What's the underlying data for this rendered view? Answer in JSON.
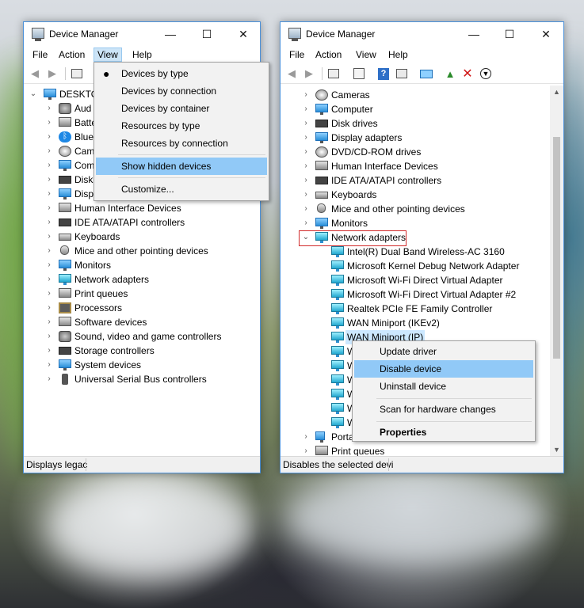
{
  "left_window": {
    "title": "Device Manager",
    "window_controls": {
      "minimize": "—",
      "maximize": "☐",
      "close": "✕"
    },
    "menu": [
      "File",
      "Action",
      "View",
      "Help"
    ],
    "active_menu": "View",
    "tree_root": "DESKTO",
    "tree_items": [
      "Aud",
      "Batte",
      "Blue",
      "Cam",
      "Com",
      "Disk",
      "Disp",
      "Human Interface Devices",
      "IDE ATA/ATAPI controllers",
      "Keyboards",
      "Mice and other pointing devices",
      "Monitors",
      "Network adapters",
      "Print queues",
      "Processors",
      "Software devices",
      "Sound, video and game controllers",
      "Storage controllers",
      "System devices",
      "Universal Serial Bus controllers"
    ],
    "status_text": "Displays legac",
    "view_menu": {
      "items": [
        {
          "label": "Devices by type",
          "checked": true
        },
        {
          "label": "Devices by connection",
          "checked": false
        },
        {
          "label": "Devices by container",
          "checked": false
        },
        {
          "label": "Resources by type",
          "checked": false
        },
        {
          "label": "Resources by connection",
          "checked": false
        }
      ],
      "show_hidden": "Show hidden devices",
      "customize": "Customize..."
    }
  },
  "right_window": {
    "title": "Device Manager",
    "window_controls": {
      "minimize": "—",
      "maximize": "☐",
      "close": "✕"
    },
    "menu": [
      "File",
      "Action",
      "View",
      "Help"
    ],
    "tree_items": [
      "Cameras",
      "Computer",
      "Disk drives",
      "Display adapters",
      "DVD/CD-ROM drives",
      "Human Interface Devices",
      "IDE ATA/ATAPI controllers",
      "Keyboards",
      "Mice and other pointing devices",
      "Monitors"
    ],
    "expanded_category": "Network adapters",
    "adapters": [
      "Intel(R) Dual Band Wireless-AC 3160",
      "Microsoft Kernel Debug Network Adapter",
      "Microsoft Wi-Fi Direct Virtual Adapter",
      "Microsoft Wi-Fi Direct Virtual Adapter #2",
      "Realtek PCIe FE Family Controller",
      "WAN Miniport (IKEv2)",
      "WAN Miniport (IP)",
      "W",
      "W",
      "W",
      "W",
      "W",
      "W"
    ],
    "after_items": [
      "Porta",
      "Print queues"
    ],
    "status_text": "Disables the selected devi",
    "context_menu": {
      "update": "Update driver",
      "disable": "Disable device",
      "uninstall": "Uninstall device",
      "scan": "Scan for hardware changes",
      "properties": "Properties"
    }
  }
}
